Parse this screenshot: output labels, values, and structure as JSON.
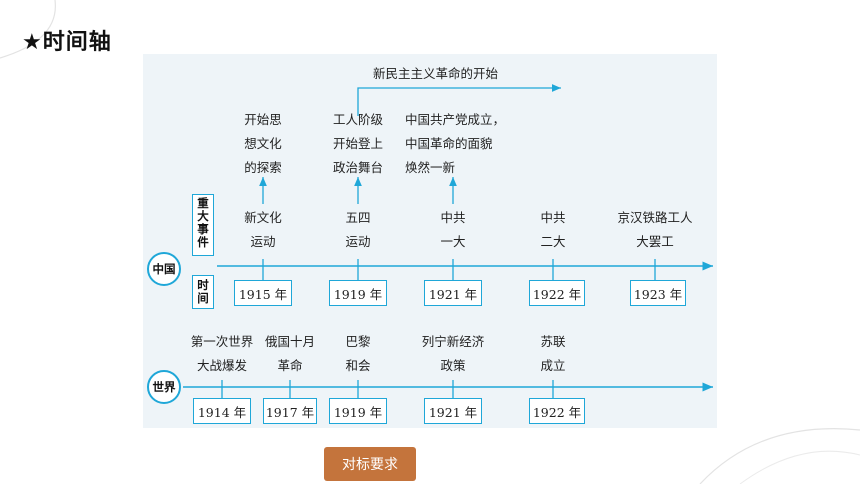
{
  "page": {
    "title": "★时间轴"
  },
  "timeline": {
    "new_revolution_label": "新民主主义革命的开始",
    "china": {
      "badge": "中国",
      "events_label": [
        "重",
        "大",
        "事",
        "件"
      ],
      "time_label": [
        "时",
        "间"
      ],
      "annotations": [
        {
          "lines": [
            "开始思",
            "想文化",
            "的探索"
          ]
        },
        {
          "lines": [
            "工人阶级",
            "开始登上",
            "政治舞台"
          ]
        },
        {
          "lines": [
            "中国共产党成立，",
            "中国革命的面貌",
            "焕然一新"
          ]
        }
      ],
      "events": [
        {
          "lines": [
            "新文化",
            "运动"
          ],
          "year": "1915 年"
        },
        {
          "lines": [
            "五四",
            "运动"
          ],
          "year": "1919 年"
        },
        {
          "lines": [
            "中共",
            "一大"
          ],
          "year": "1921 年"
        },
        {
          "lines": [
            "中共",
            "二大"
          ],
          "year": "1922 年"
        },
        {
          "lines": [
            "京汉铁路工人",
            "大罢工"
          ],
          "year": "1923 年"
        }
      ]
    },
    "world": {
      "badge": "世界",
      "events": [
        {
          "lines": [
            "第一次世界",
            "大战爆发"
          ],
          "year": "1914 年"
        },
        {
          "lines": [
            "俄国十月",
            "革命"
          ],
          "year": "1917 年"
        },
        {
          "lines": [
            "巴黎",
            "和会"
          ],
          "year": "1919 年"
        },
        {
          "lines": [
            "列宁新经济",
            "政策"
          ],
          "year": "1921 年"
        },
        {
          "lines": [
            "苏联",
            "成立"
          ],
          "year": "1922 年"
        }
      ]
    }
  },
  "footer": {
    "button_label": "对标要求"
  },
  "colors": {
    "accent": "#1fa7d8",
    "button": "#c4743c",
    "panel": "#eef4f8"
  }
}
